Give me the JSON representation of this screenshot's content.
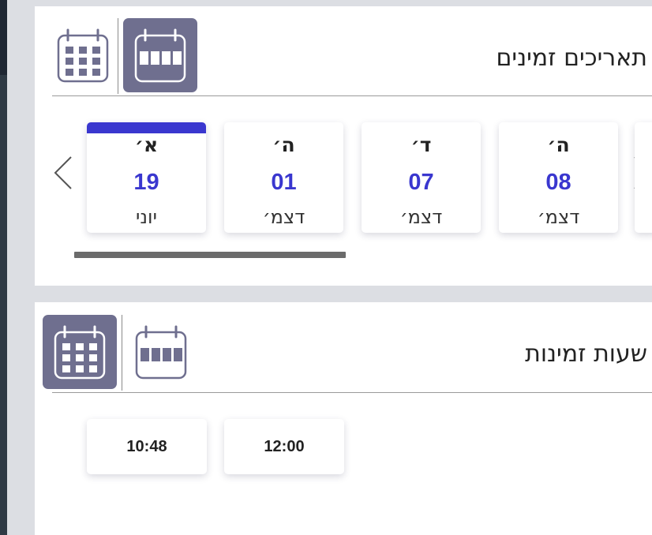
{
  "dates_panel": {
    "title": "תאריכים זמינים",
    "view_toggles": [
      {
        "icon": "calendar-grid-icon",
        "active": false
      },
      {
        "icon": "calendar-week-icon",
        "active": true
      }
    ],
    "cards": [
      {
        "dow": "א׳",
        "day": "19",
        "month": "יוני",
        "selected": true
      },
      {
        "dow": "ה׳",
        "day": "01",
        "month": "דצמ׳",
        "selected": false
      },
      {
        "dow": "ד׳",
        "day": "07",
        "month": "דצמ׳",
        "selected": false
      },
      {
        "dow": "ה׳",
        "day": "08",
        "month": "דצמ׳",
        "selected": false
      }
    ]
  },
  "hours_panel": {
    "title": "שעות זמינות",
    "view_toggles": [
      {
        "icon": "calendar-grid-icon",
        "active": true
      },
      {
        "icon": "calendar-week-icon",
        "active": false
      }
    ],
    "times": [
      "10:48",
      "12:00"
    ]
  },
  "colors": {
    "accent": "#3a37cf",
    "toggle_active": "#6f6f8f",
    "background": "#dcdee3"
  }
}
